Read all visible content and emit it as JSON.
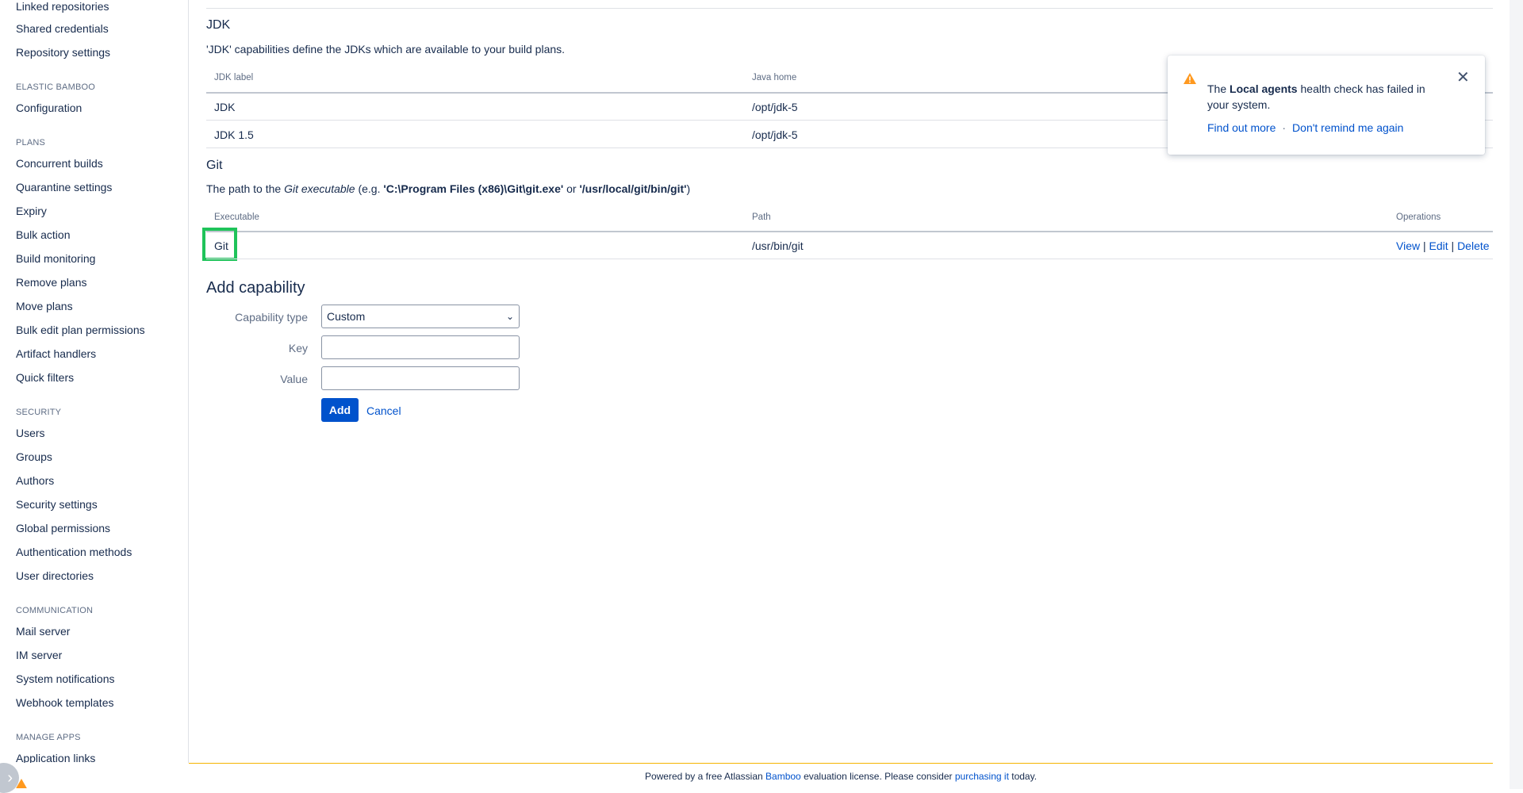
{
  "sidebar": {
    "items_top": [
      "Linked repositories",
      "Shared credentials",
      "Repository settings"
    ],
    "sections": [
      {
        "heading": "ELASTIC BAMBOO",
        "items": [
          "Configuration"
        ]
      },
      {
        "heading": "PLANS",
        "items": [
          "Concurrent builds",
          "Quarantine settings",
          "Expiry",
          "Bulk action",
          "Build monitoring",
          "Remove plans",
          "Move plans",
          "Bulk edit plan permissions",
          "Artifact handlers",
          "Quick filters"
        ]
      },
      {
        "heading": "SECURITY",
        "items": [
          "Users",
          "Groups",
          "Authors",
          "Security settings",
          "Global permissions",
          "Authentication methods",
          "User directories"
        ]
      },
      {
        "heading": "COMMUNICATION",
        "items": [
          "Mail server",
          "IM server",
          "System notifications",
          "Webhook templates"
        ]
      },
      {
        "heading": "MANAGE APPS",
        "items": [
          "Application links"
        ]
      }
    ]
  },
  "jdk": {
    "title": "JDK",
    "description": "'JDK' capabilities define the JDKs which are available to your build plans.",
    "columns": [
      "JDK label",
      "Java home"
    ],
    "rows": [
      {
        "label": "JDK",
        "home": "/opt/jdk-5"
      },
      {
        "label": "JDK 1.5",
        "home": "/opt/jdk-5"
      }
    ]
  },
  "git": {
    "title": "Git",
    "desc_pre": "The path to the ",
    "desc_em": "Git executable",
    "desc_mid1": " (e.g. ",
    "desc_b1": "'C:\\Program Files (x86)\\Git\\git.exe'",
    "desc_mid2": " or ",
    "desc_b2": "'/usr/local/git/bin/git'",
    "desc_end": ")",
    "columns": [
      "Executable",
      "Path",
      "Operations"
    ],
    "row": {
      "executable": "Git",
      "path": "/usr/bin/git"
    },
    "ops": {
      "view": "View",
      "edit": "Edit",
      "delete": "Delete",
      "sep": "|"
    }
  },
  "add_capability": {
    "title": "Add capability",
    "type_label": "Capability type",
    "type_value": "Custom",
    "key_label": "Key",
    "value_label": "Value",
    "add_button": "Add",
    "cancel": "Cancel"
  },
  "flag": {
    "text_pre": "The ",
    "text_bold": "Local agents",
    "text_post": " health check has failed in your system.",
    "find_out_more": "Find out more",
    "sep": "·",
    "dont_remind": "Don't remind me again",
    "close": "✕"
  },
  "footer": {
    "pre": "Powered by a free Atlassian ",
    "bamboo": "Bamboo",
    "mid": " evaluation license. Please consider ",
    "purchasing": "purchasing it",
    "post": " today."
  },
  "colors": {
    "link": "#0052cc",
    "primary_button": "#0052cc",
    "highlight": "#1fc35a",
    "warning": "#ff991f",
    "footer_border": "#f5b400"
  }
}
